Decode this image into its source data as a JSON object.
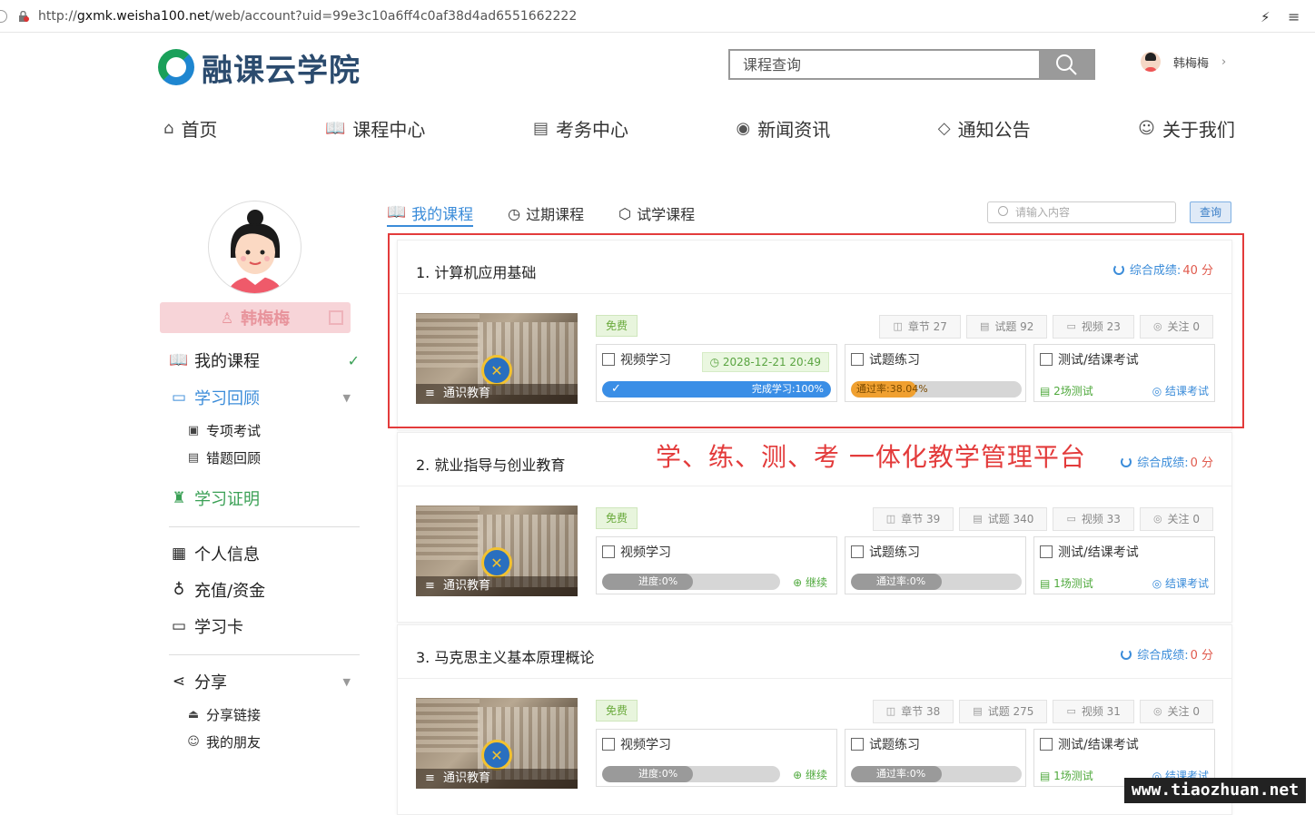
{
  "browser": {
    "url_prefix": "http://",
    "url_host": "gxmk.weisha100.net",
    "url_path": "/web/account?uid=99e3c10a6ff4c0af38d4ad6551662222"
  },
  "header": {
    "logo_text": "融课云学院",
    "search_placeholder": "课程查询",
    "user_name": "韩梅梅"
  },
  "nav": [
    "首页",
    "课程中心",
    "考务中心",
    "新闻资讯",
    "通知公告",
    "关于我们"
  ],
  "sidebar": {
    "name": "韩梅梅",
    "my_courses": "我的课程",
    "review": "学习回顾",
    "review_subs": [
      "专项考试",
      "错题回顾"
    ],
    "certificate": "学习证明",
    "profile": "个人信息",
    "recharge": "充值/资金",
    "card": "学习卡",
    "share": "分享",
    "share_subs": [
      "分享链接",
      "我的朋友"
    ]
  },
  "tabs": {
    "items": [
      "我的课程",
      "过期课程",
      "试学课程"
    ],
    "active": "我的课程",
    "search_placeholder": "请输入内容",
    "query": "查询"
  },
  "labels": {
    "score": "综合成绩:",
    "free": "免费",
    "video": "视频学习",
    "exercise": "试题练习",
    "test": "测试/结课考试",
    "continue": "继续",
    "end_exam": "结课考试"
  },
  "courses": [
    {
      "title": "1. 计算机应用基础",
      "score": "40 分",
      "chapters": "章节 27",
      "questions": "试题 92",
      "videos": "视频 23",
      "follows": "关注 0",
      "video_label": "完成学习:100%",
      "video_progress": 100,
      "date": "2028-12-21 20:49",
      "pass_label": "通过率:38.04%",
      "pass_rate": 38.04,
      "tests": "2场测试",
      "thumb_caption": "通识教育"
    },
    {
      "title": "2. 就业指导与创业教育",
      "score": "0 分",
      "chapters": "章节 39",
      "questions": "试题 340",
      "videos": "视频 33",
      "follows": "关注 0",
      "video_label": "进度:0%",
      "video_progress": 0,
      "date": "",
      "pass_label": "通过率:0%",
      "pass_rate": 0,
      "tests": "1场测试",
      "thumb_caption": "通识教育"
    },
    {
      "title": "3. 马克思主义基本原理概论",
      "score": "0 分",
      "chapters": "章节 38",
      "questions": "试题 275",
      "videos": "视频 31",
      "follows": "关注 0",
      "video_label": "进度:0%",
      "video_progress": 0,
      "date": "",
      "pass_label": "通过率:0%",
      "pass_rate": 0,
      "tests": "1场测试",
      "thumb_caption": "通识教育"
    }
  ],
  "slogan": "学、练、测、考 一体化教学管理平台",
  "watermark": "www.tiaozhuan.net",
  "colors": {
    "accent": "#3b8cd9",
    "green": "#4fa93c",
    "red": "#e33b3b",
    "orange": "#f0a030"
  }
}
